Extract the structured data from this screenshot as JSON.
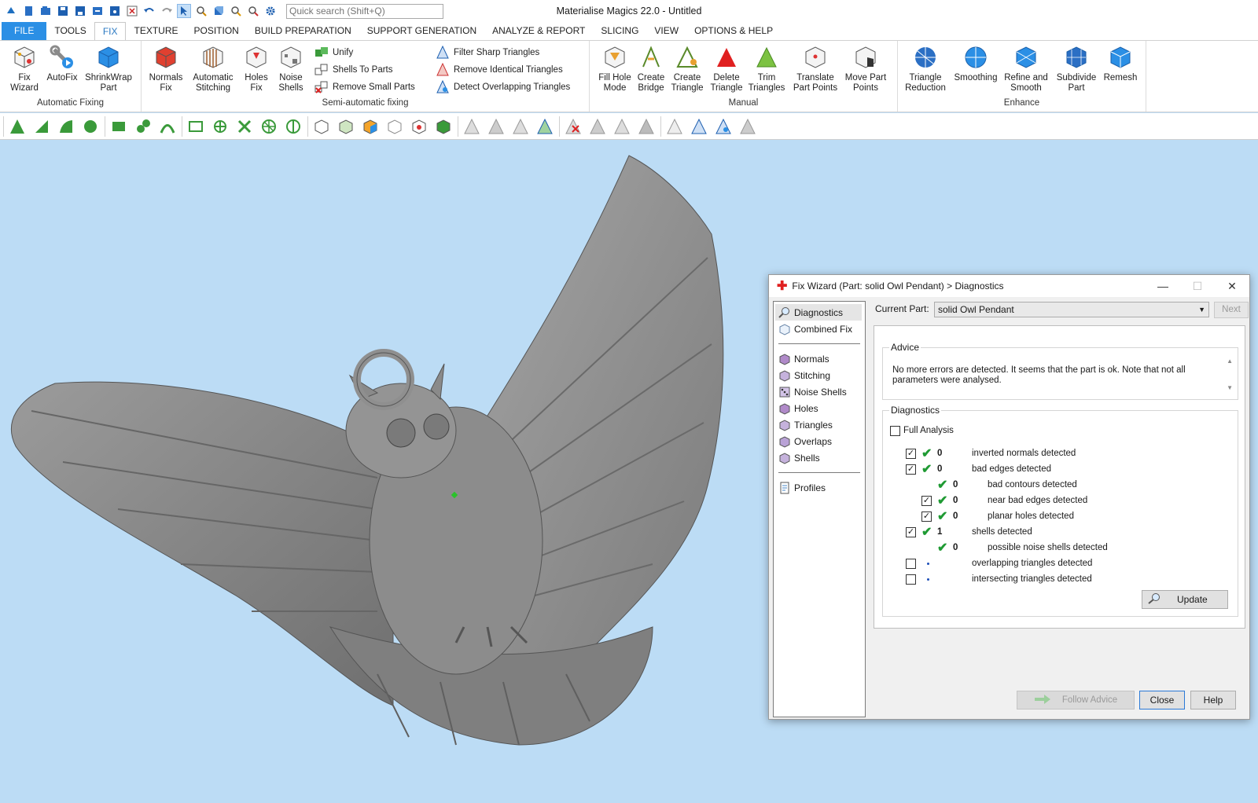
{
  "app": {
    "title": "Materialise Magics 22.0 - Untitled",
    "search_placeholder": "Quick search (Shift+Q)"
  },
  "menu": {
    "tabs": [
      "FILE",
      "TOOLS",
      "FIX",
      "TEXTURE",
      "POSITION",
      "BUILD PREPARATION",
      "SUPPORT GENERATION",
      "ANALYZE & REPORT",
      "SLICING",
      "VIEW",
      "OPTIONS & HELP"
    ],
    "active": "FIX"
  },
  "ribbon": {
    "auto": {
      "label": "Automatic Fixing",
      "fix_wizard": "Fix Wizard",
      "autofix": "AutoFix",
      "shrinkwrap": "ShrinkWrap Part"
    },
    "semi": {
      "label": "Semi-automatic fixing",
      "normals_fix": "Normals Fix",
      "auto_stitching": "Automatic Stitching",
      "holes_fix": "Holes Fix",
      "noise_shells": "Noise Shells",
      "unify": "Unify",
      "shells_to_parts": "Shells To Parts",
      "remove_small_parts": "Remove Small Parts",
      "filter_sharp": "Filter Sharp Triangles",
      "remove_identical": "Remove Identical Triangles",
      "detect_overlapping": "Detect Overlapping Triangles"
    },
    "manual": {
      "label": "Manual",
      "fill_hole": "Fill Hole Mode",
      "create_bridge": "Create Bridge",
      "create_triangle": "Create Triangle",
      "delete_triangle": "Delete Triangle",
      "trim_triangles": "Trim Triangles",
      "translate_points": "Translate Part Points",
      "move_points": "Move Part Points"
    },
    "enhance": {
      "label": "Enhance",
      "tri_reduction": "Triangle Reduction",
      "smoothing": "Smoothing",
      "refine_smooth": "Refine and Smooth",
      "subdivide": "Subdivide Part",
      "remesh": "Remesh"
    }
  },
  "dialog": {
    "title": "Fix Wizard (Part: solid Owl Pendant) > Diagnostics",
    "nav": {
      "diagnostics": "Diagnostics",
      "combined_fix": "Combined Fix",
      "normals": "Normals",
      "stitching": "Stitching",
      "noise_shells": "Noise Shells",
      "holes": "Holes",
      "triangles": "Triangles",
      "overlaps": "Overlaps",
      "shells": "Shells",
      "profiles": "Profiles"
    },
    "current_part_label": "Current Part:",
    "current_part": "solid Owl Pendant",
    "next": "Next",
    "advice_legend": "Advice",
    "advice_text": "No more errors are detected. It seems that the part is ok. Note that not all parameters were analysed.",
    "diag_legend": "Diagnostics",
    "full_analysis": "Full Analysis",
    "rows": [
      {
        "count": "0",
        "label": "inverted normals detected"
      },
      {
        "count": "0",
        "label": "bad edges detected"
      },
      {
        "count": "0",
        "label": "bad contours detected"
      },
      {
        "count": "0",
        "label": "near bad edges detected"
      },
      {
        "count": "0",
        "label": "planar holes detected"
      },
      {
        "count": "1",
        "label": "shells detected"
      },
      {
        "count": "0",
        "label": "possible noise shells detected"
      },
      {
        "count": "",
        "label": "overlapping triangles detected"
      },
      {
        "count": "",
        "label": "intersecting triangles detected"
      }
    ],
    "update": "Update",
    "follow_advice": "Follow Advice",
    "close": "Close",
    "help": "Help"
  },
  "colors": {
    "accent": "#2b8fe5",
    "viewport": "#bcdcf5",
    "model": "#8a8a8a",
    "check": "#1f9a33"
  }
}
